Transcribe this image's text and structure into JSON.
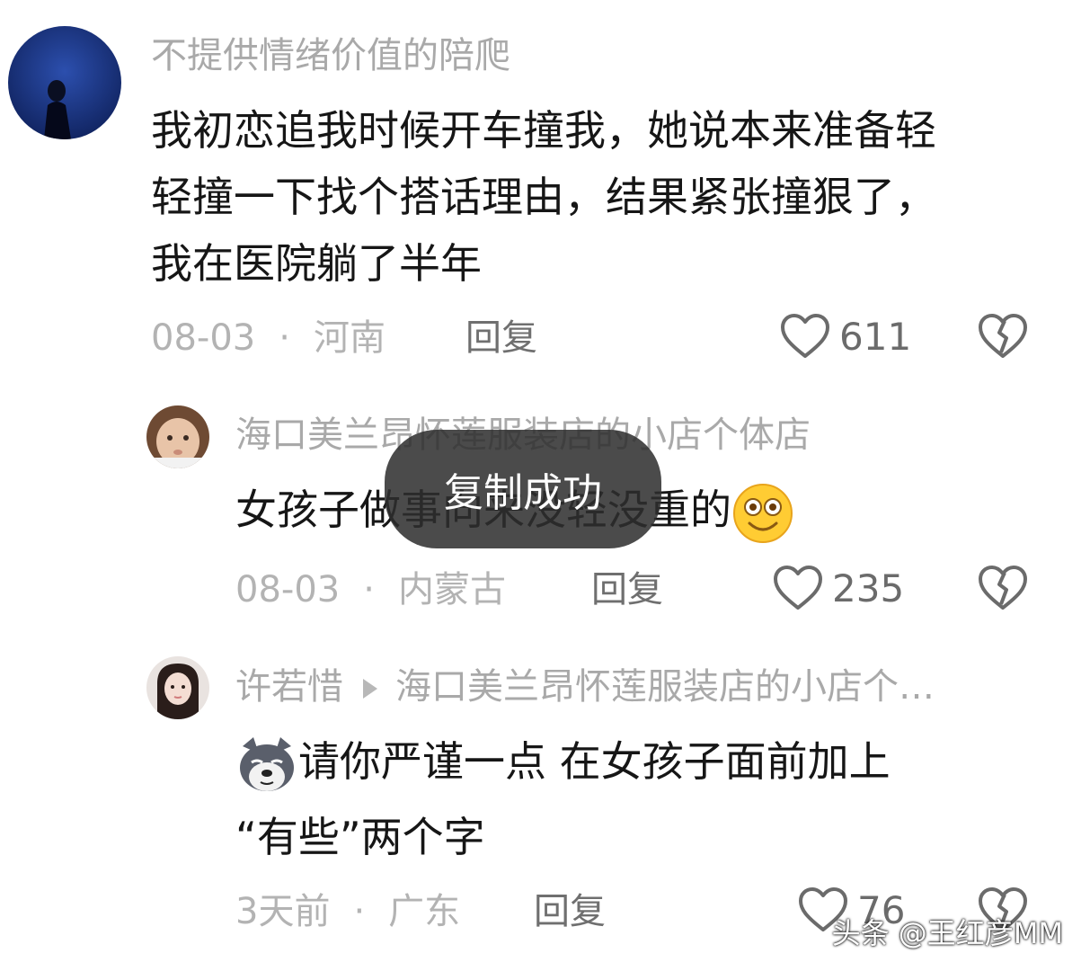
{
  "comments": [
    {
      "username": "不提供情绪价值的陪爬",
      "text_lines": [
        "我初恋追我时候开车撞我，她说本来准备轻",
        "轻撞一下找个搭话理由，结果紧张撞狠了，",
        "我在医院躺了半年"
      ],
      "date": "08-03",
      "location": "河南",
      "reply_label": "回复",
      "likes": "611"
    },
    {
      "username": "海口美兰昂怀莲服装店的小店个体店",
      "text": "女孩子做事向来没轻没重的",
      "emoji": "grinning-face-icon",
      "date": "08-03",
      "location": "内蒙古",
      "reply_label": "回复",
      "likes": "235"
    },
    {
      "username": "许若惜",
      "reply_to": "海口美兰昂怀莲服装店的小店个…",
      "sticker": "husky-dog-icon",
      "text_lines": [
        "请你严谨一点 在女孩子面前加上",
        "“有些”两个字"
      ],
      "date": "3天前",
      "location": "广东",
      "reply_label": "回复",
      "likes": "76"
    }
  ],
  "separator": "·",
  "toast": "复制成功",
  "watermark": "头条 @王红彦MM",
  "colors": {
    "username": "#a9a9a9",
    "body": "#161616",
    "meta": "#b3b3b3",
    "toast_bg": "#2d2d2d"
  }
}
